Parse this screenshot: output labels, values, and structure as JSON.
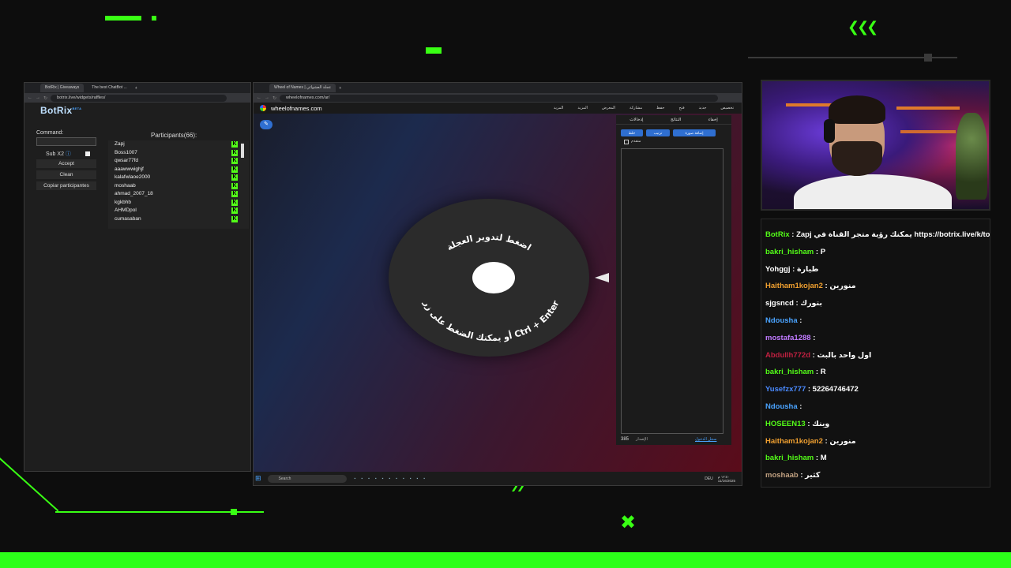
{
  "botrix_window": {
    "tabs": [
      "BotRix | Giveaways",
      "The best ChatBot ..."
    ],
    "url": "botrix.live/widgets/raffles/",
    "logo": "BotRix",
    "logo_badge": "BETA",
    "command_label": "Command:",
    "sub_label": "Sub X2",
    "buttons": [
      "Accept",
      "Clean",
      "Copiar participantes"
    ],
    "participants_title": "Participants(66):",
    "participants": [
      "Zapj",
      "Boss1007",
      "qwsar77fd",
      "aaawwwighjf",
      "kalafwlaoe2000",
      "moshaab",
      "ahmad_2007_18",
      "kgkbhb",
      "AHMDpol",
      "cumasaban"
    ],
    "kick_badge": "K"
  },
  "wheel_window": {
    "tabs": [
      "Wheel of Names | عجلة العشوائي"
    ],
    "url": "wheelofnames.com/ar/",
    "site_name": "wheelofnames.com",
    "menu": [
      "المزيد",
      "المزيد",
      "المعرض",
      "مشاركة",
      "حفظ",
      "فتح",
      "جديد",
      "تخصيص"
    ],
    "panel_tabs": [
      "إدخالات",
      "النتائج",
      "إخفاء"
    ],
    "panel_buttons": [
      "خلط",
      "ترتيب",
      "إضافة صورة"
    ],
    "panel_checkbox": "متقدم",
    "entries_count_label": "الإصدار",
    "entries_count": "385",
    "login_link": "سجل الدخول",
    "wheel_text_top": "اضغط لتدوير العجلة",
    "wheel_text_bottom": "أو يمكنك الضغط على زر Ctrl + Enter",
    "taskbar_search": "Search",
    "taskbar_lang": "DEU",
    "taskbar_time": "١٢:٥٠ م",
    "taskbar_date": "11/16/2025"
  },
  "chat": {
    "messages": [
      {
        "user": "BotRix",
        "text": " : Zapj يمكنك رؤية متجر القناة في https://botrix.live/k/tormando/shop",
        "color": "#53fc18"
      },
      {
        "user": "bakri_hisham",
        "text": " : P",
        "color": "#53fc18"
      },
      {
        "user": "Yohggj",
        "text": " : طيارة",
        "color": "#ffffff"
      },
      {
        "user": "Haitham1kojan2",
        "text": " : منورين",
        "color": "#f0a030"
      },
      {
        "user": "sjgsncd",
        "text": " : بتورك",
        "color": "#ffffff"
      },
      {
        "user": "Ndousha",
        "text": " :",
        "color": "#4aa3ff"
      },
      {
        "user": "mostafa1288",
        "text": " :",
        "color": "#c07aff"
      },
      {
        "user": "Abdullh772d",
        "text": " : اول واحد بالبث",
        "color": "#c02040"
      },
      {
        "user": "bakri_hisham",
        "text": " : R",
        "color": "#53fc18"
      },
      {
        "user": "Yusefzx777",
        "text": " : 52264746472",
        "color": "#4a8aff"
      },
      {
        "user": "Ndousha",
        "text": " :",
        "color": "#4aa3ff"
      },
      {
        "user": "HOSEEN13",
        "text": " : وينك",
        "color": "#53fc18"
      },
      {
        "user": "Haitham1kojan2",
        "text": " : منورين",
        "color": "#f0a030"
      },
      {
        "user": "bakri_hisham",
        "text": " : M",
        "color": "#53fc18"
      },
      {
        "user": "moshaab",
        "text": " : كثير",
        "color": "#c0a080"
      }
    ]
  },
  "colors": {
    "accent_green": "#39ff14",
    "kick_green": "#53fc18"
  }
}
